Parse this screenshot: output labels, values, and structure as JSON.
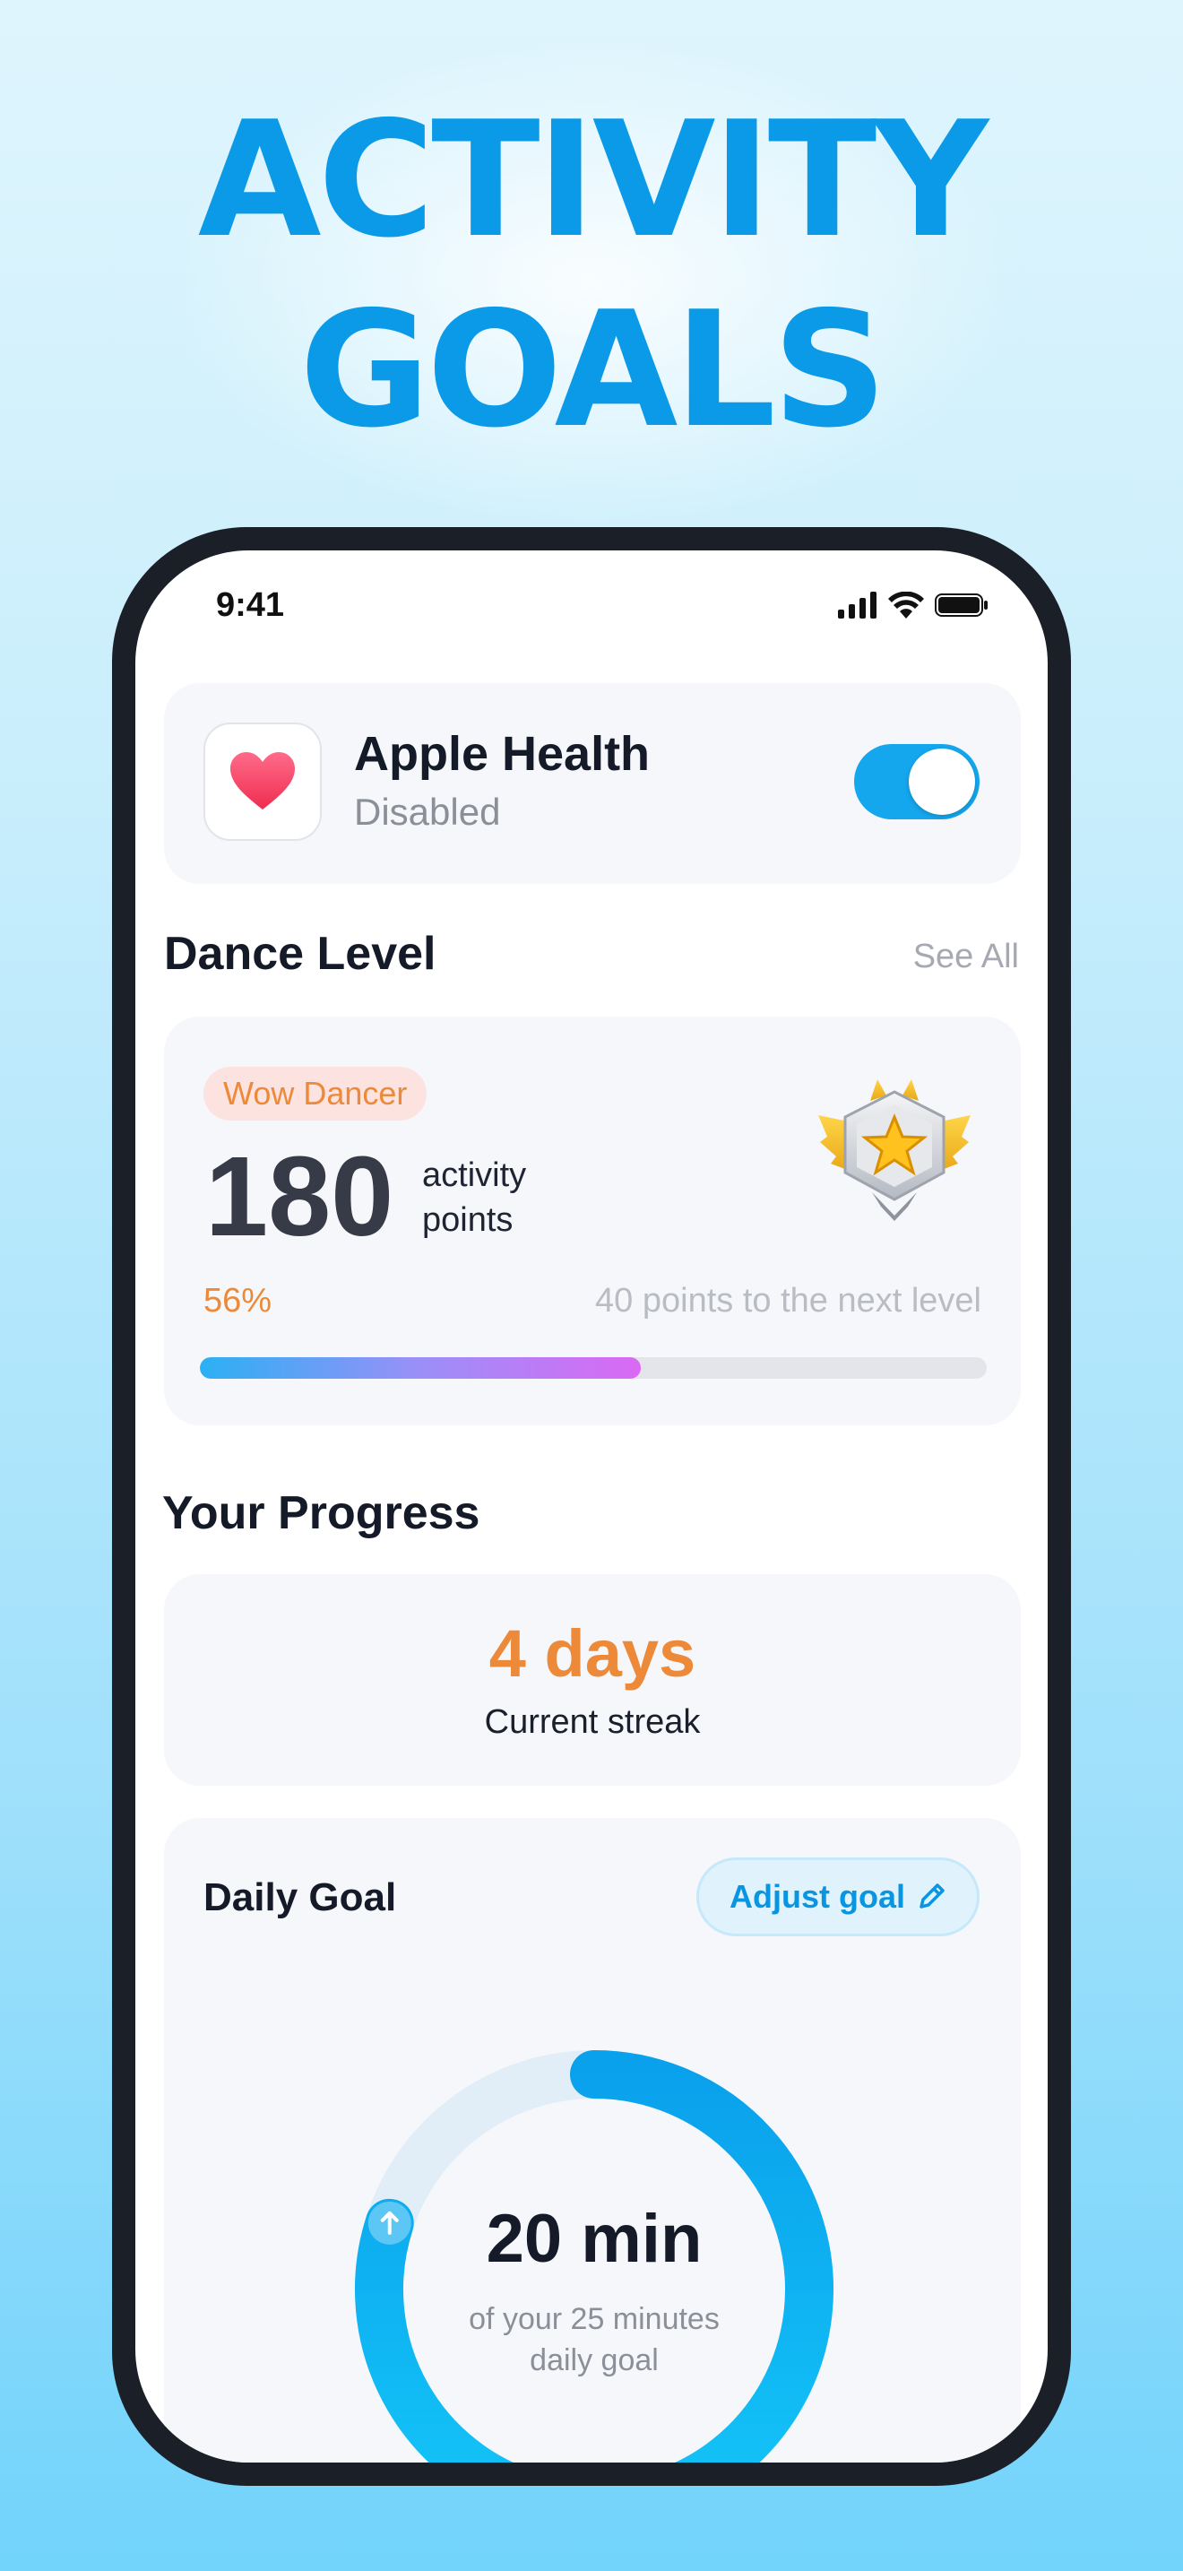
{
  "headline": {
    "line1": "ACTIVITY",
    "line2": "GOALS"
  },
  "status_bar": {
    "time": "9:41"
  },
  "apple_health": {
    "title": "Apple Health",
    "status": "Disabled",
    "toggle_on": true
  },
  "dance_level": {
    "section_title": "Dance Level",
    "see_all": "See All",
    "badge": "Wow Dancer",
    "points": "180",
    "points_label_line1": "activity",
    "points_label_line2": "points",
    "progress_text": "56%",
    "progress_value": 0.56,
    "next_level_text": "40 points to the next level"
  },
  "progress": {
    "section_title": "Your Progress",
    "streak_value": "4 days",
    "streak_label": "Current streak"
  },
  "daily_goal": {
    "title": "Daily Goal",
    "adjust_button": "Adjust goal",
    "value": "20 min",
    "caption_line1": "of your 25 minutes",
    "caption_line2": "daily goal",
    "completed_minutes": 20,
    "goal_minutes": 25
  },
  "colors": {
    "brand_blue": "#0a9ae8",
    "accent_orange": "#ec8a3a",
    "toggle_blue": "#15a7ee"
  },
  "icons": [
    "heart-icon",
    "medal-icon",
    "pencil-icon",
    "arrow-up-icon",
    "signal-icon",
    "wifi-icon",
    "battery-icon"
  ]
}
